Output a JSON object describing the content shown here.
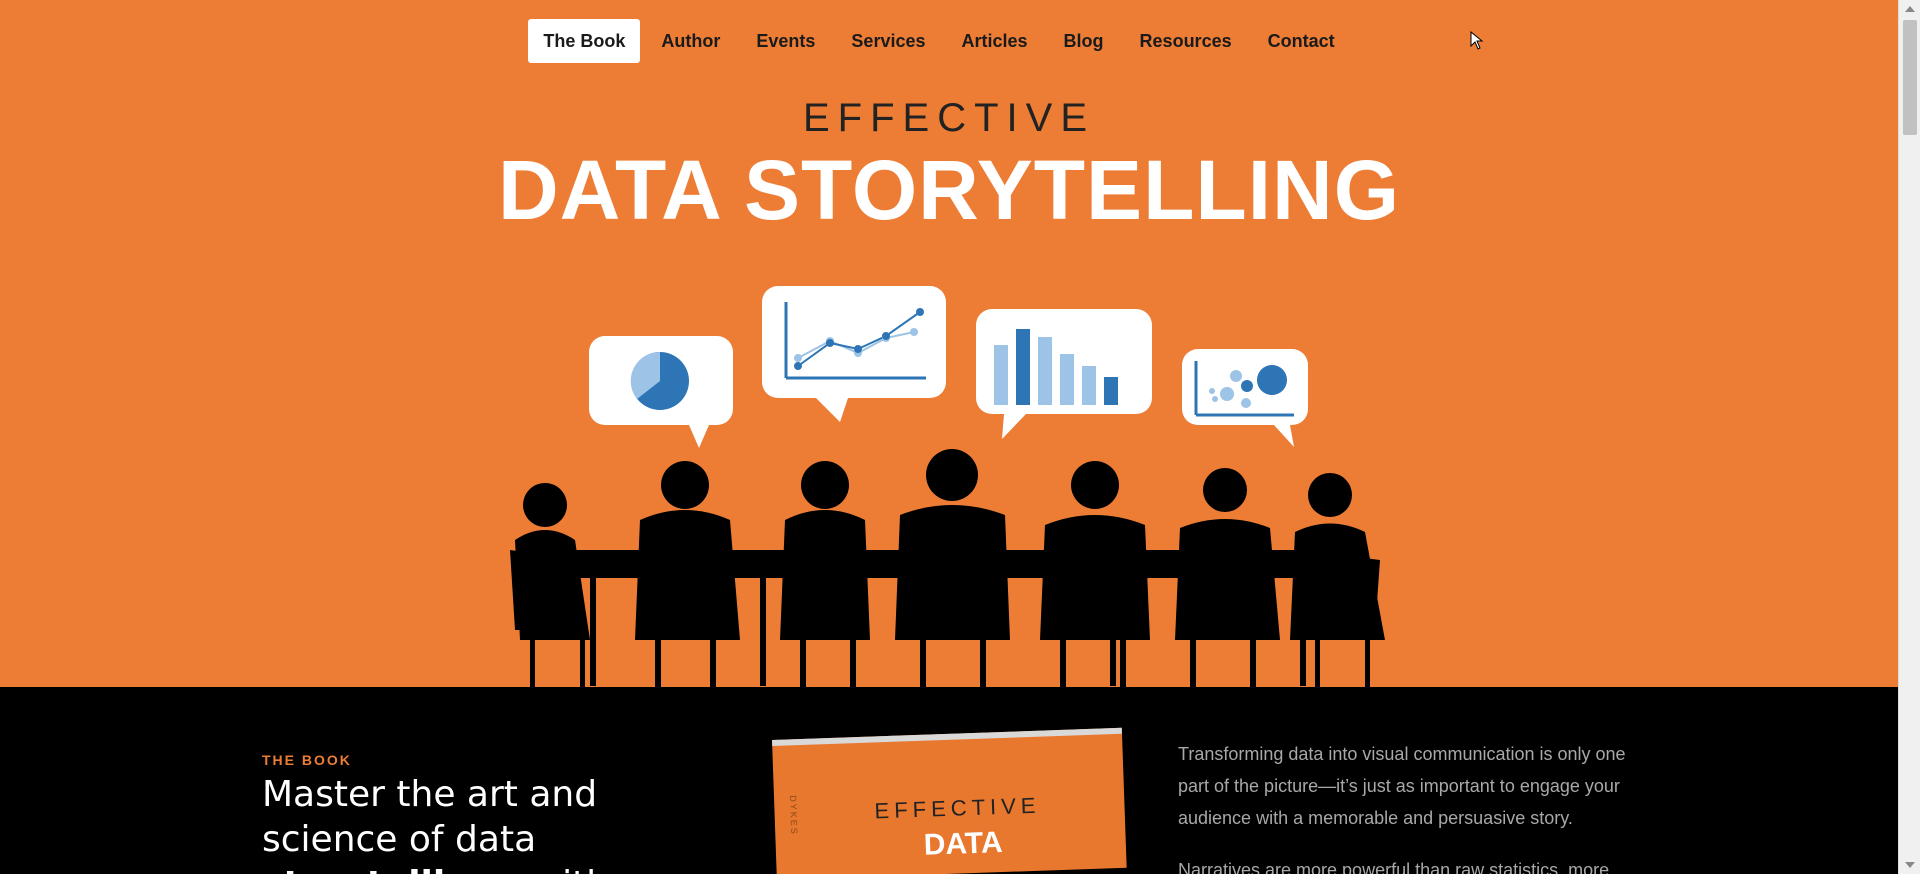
{
  "nav": {
    "items": [
      {
        "label": "The Book",
        "active": true
      },
      {
        "label": "Author"
      },
      {
        "label": "Events"
      },
      {
        "label": "Services"
      },
      {
        "label": "Articles"
      },
      {
        "label": "Blog"
      },
      {
        "label": "Resources"
      },
      {
        "label": "Contact"
      }
    ]
  },
  "hero": {
    "eyebrow": "EFFECTIVE",
    "title": "DATA STORYTELLING",
    "background_color": "#ED7D35",
    "bubbles": [
      "pie-chart-icon",
      "line-chart-icon",
      "bar-chart-icon",
      "scatter-chart-icon"
    ]
  },
  "book_section": {
    "label": "THE BOOK",
    "headline_pre": "Master the art and science of data ",
    "headline_strong": "storytelling",
    "headline_post": "—with",
    "cover_eyebrow": "EFFECTIVE",
    "cover_title": "DATA",
    "cover_spine": "DYKES",
    "paragraph_1": "Transforming data into visual communication is only one part of the picture—it’s just as important to engage your audience with a memorable and persuasive story.",
    "paragraph_2": "Narratives are more powerful than raw statistics, more"
  },
  "colors": {
    "accent": "#ED7D35",
    "chart_dark_blue": "#2E75B6",
    "chart_light_blue": "#9DC3E6"
  }
}
